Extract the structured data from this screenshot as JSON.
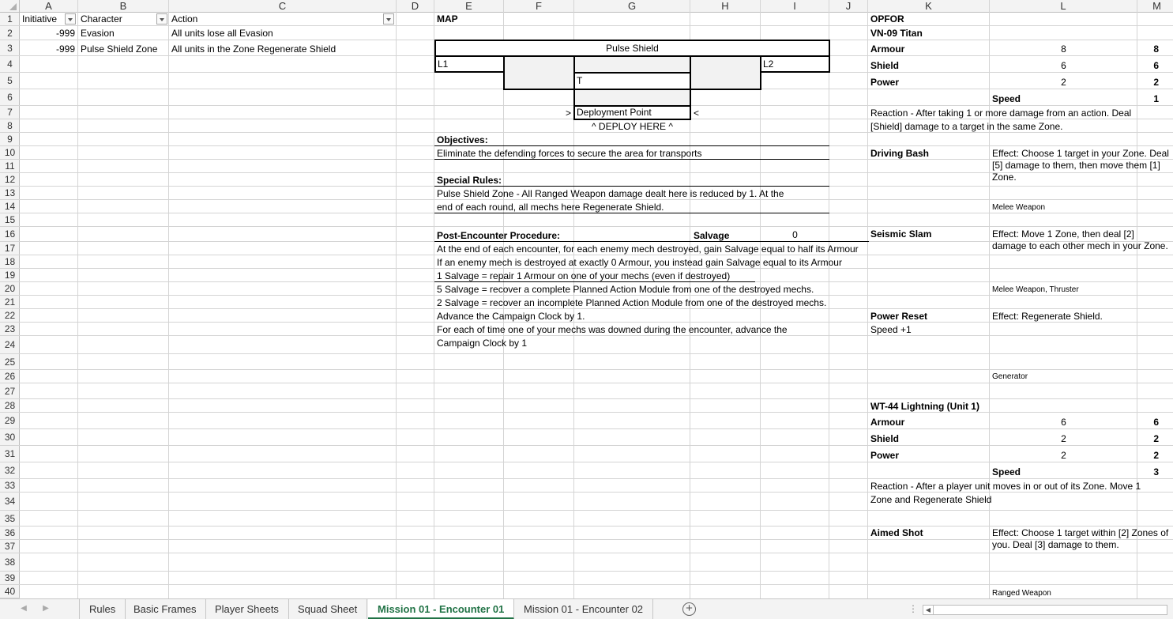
{
  "columns": [
    "A",
    "B",
    "C",
    "D",
    "E",
    "F",
    "G",
    "H",
    "I",
    "J",
    "K",
    "L",
    "M"
  ],
  "rows": [
    "1",
    "2",
    "3",
    "4",
    "5",
    "6",
    "7",
    "8",
    "9",
    "10",
    "11",
    "12",
    "13",
    "14",
    "15",
    "16",
    "17",
    "18",
    "19",
    "20",
    "21",
    "22",
    "23",
    "24",
    "25",
    "26",
    "27",
    "28",
    "29",
    "30",
    "31",
    "32",
    "33",
    "34",
    "35",
    "36",
    "37",
    "38",
    "39",
    "40"
  ],
  "table": {
    "headers": [
      "Initiative",
      "Character",
      "Action"
    ],
    "rows": [
      {
        "initiative": "-999",
        "character": "Evasion",
        "action": "All units lose all Evasion"
      },
      {
        "initiative": "-999",
        "character": "Pulse Shield Zone",
        "action": "All units in the Zone Regenerate Shield"
      }
    ]
  },
  "map": {
    "title": "MAP",
    "pulse_shield": "Pulse Shield",
    "l1": "L1",
    "l2": "L2",
    "t": "T",
    "deploy_left": ">",
    "deploy_point": "Deployment Point",
    "deploy_right": "<",
    "deploy_here": "^ DEPLOY HERE ^"
  },
  "objectives": {
    "title": "Objectives:",
    "text": "Eliminate the defending forces to secure the area for transports"
  },
  "special_rules": {
    "title": "Special Rules:",
    "line1": "Pulse Shield Zone - All Ranged Weapon damage dealt here is reduced by 1. At the",
    "line2": "end of each round, all mechs here Regenerate Shield."
  },
  "post": {
    "title": "Post-Encounter Procedure:",
    "salvage_label": "Salvage",
    "salvage_value": "0",
    "lines": [
      "At the end of each encounter, for each enemy mech destroyed, gain Salvage equal to half its Armour",
      "If an enemy mech is destroyed at exactly 0 Armour, you instead gain Salvage equal to its Armour",
      "1 Salvage = repair 1 Armour on one of your mechs (even if destroyed)",
      "5 Salvage = recover a complete Planned Action Module from one of the destroyed mechs.",
      "2 Salvage = recover an incomplete Planned Action Module from one of the destroyed mechs.",
      "Advance the Campaign Clock by 1.",
      "For each of time one of your mechs was downed during the encounter, advance the",
      "Campaign Clock by 1"
    ]
  },
  "opfor": {
    "title": "OPFOR",
    "unit1": {
      "name": "VN-09 Titan",
      "armour_label": "Armour",
      "armour_val": "8",
      "armour_max": "8",
      "shield_label": "Shield",
      "shield_val": "6",
      "shield_max": "6",
      "power_label": "Power",
      "power_val": "2",
      "power_max": "2",
      "speed_label": "Speed",
      "speed_val": "1",
      "reaction_line1": "Reaction - After taking 1 or more damage from an action. Deal",
      "reaction_line2": "[Shield] damage to a target in the same Zone.",
      "actions": [
        {
          "name": "Driving Bash",
          "effect": "Effect: Choose 1 target in your Zone. Deal [5] damage to them, then move them [1] Zone.",
          "tag": "Melee Weapon",
          "sub": ""
        },
        {
          "name": "Seismic Slam",
          "effect": "Effect: Move 1 Zone, then deal [2] damage to each other mech in your Zone.",
          "tag": "Melee Weapon, Thruster",
          "sub": ""
        },
        {
          "name": "Power Reset",
          "effect": "Effect: Regenerate Shield.",
          "tag": "Generator",
          "sub": "Speed +1"
        }
      ]
    },
    "unit2": {
      "name": "WT-44 Lightning (Unit 1)",
      "armour_label": "Armour",
      "armour_val": "6",
      "armour_max": "6",
      "shield_label": "Shield",
      "shield_val": "2",
      "shield_max": "2",
      "power_label": "Power",
      "power_val": "2",
      "power_max": "2",
      "speed_label": "Speed",
      "speed_val": "3",
      "reaction_line1": "Reaction - After a player unit moves in or out of its Zone. Move 1",
      "reaction_line2": "Zone and Regenerate Shield",
      "actions": [
        {
          "name": "Aimed Shot",
          "effect": "Effect: Choose 1 target within [2] Zones of you. Deal [3] damage to them.",
          "tag": "Ranged Weapon",
          "sub": ""
        }
      ]
    }
  },
  "tabs": [
    "Rules",
    "Basic Frames",
    "Player Sheets",
    "Squad Sheet",
    "Mission 01 - Encounter 01",
    "Mission 01 - Encounter 02"
  ],
  "active_tab": "Mission 01 - Encounter 01",
  "add_sheet": "+"
}
